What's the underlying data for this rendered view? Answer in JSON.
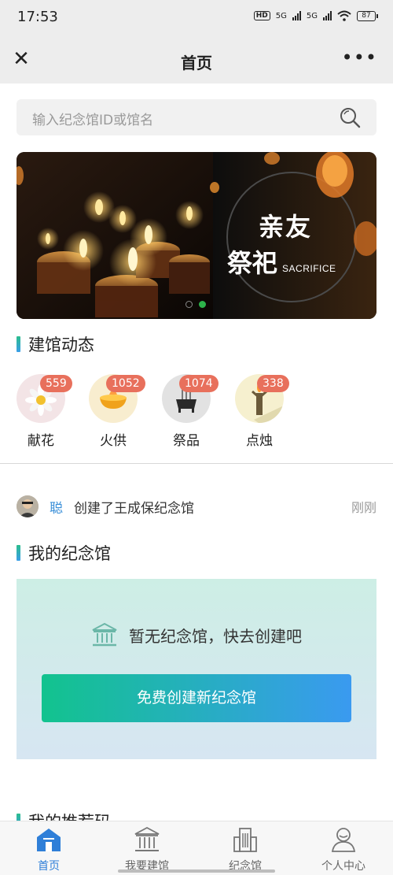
{
  "status_bar": {
    "time": "17:53",
    "network_a": "5G",
    "network_b": "5G",
    "hd_label": "HD",
    "battery": "87"
  },
  "nav": {
    "title": "首页",
    "close_icon": "close-icon",
    "more_icon": "more-dots-icon"
  },
  "search": {
    "placeholder": "输入纪念馆ID或馆名",
    "icon": "search-icon"
  },
  "banner": {
    "text_line1": "亲友",
    "text_line2": "祭祀",
    "text_en": "SACRIFICE",
    "slide_count": 2,
    "active_slide": 2
  },
  "activity": {
    "title": "建馆动态",
    "items": [
      {
        "label": "献花",
        "count": "559",
        "icon": "flower-icon"
      },
      {
        "label": "火供",
        "count": "1052",
        "icon": "fire-offering-icon"
      },
      {
        "label": "祭品",
        "count": "1074",
        "icon": "censer-icon"
      },
      {
        "label": "点烛",
        "count": "338",
        "icon": "candle-icon"
      }
    ]
  },
  "feed": {
    "user": "聪",
    "text": "创建了王成保纪念馆",
    "time": "刚刚"
  },
  "my_memorial": {
    "title": "我的纪念馆",
    "empty_text": "暂无纪念馆，快去创建吧",
    "create_button": "免费创建新纪念馆"
  },
  "next_section": {
    "title": "我的推荐码"
  },
  "tabs": [
    {
      "label": "首页",
      "icon": "home-icon",
      "active": true
    },
    {
      "label": "我要建馆",
      "icon": "build-hall-icon",
      "active": false
    },
    {
      "label": "纪念馆",
      "icon": "memorial-building-icon",
      "active": false
    },
    {
      "label": "个人中心",
      "icon": "user-center-icon",
      "active": false
    }
  ],
  "colors": {
    "accent_blue": "#2f7fd8",
    "badge": "#e8705c",
    "button_start": "#12c38e",
    "button_end": "#3a9af0"
  }
}
